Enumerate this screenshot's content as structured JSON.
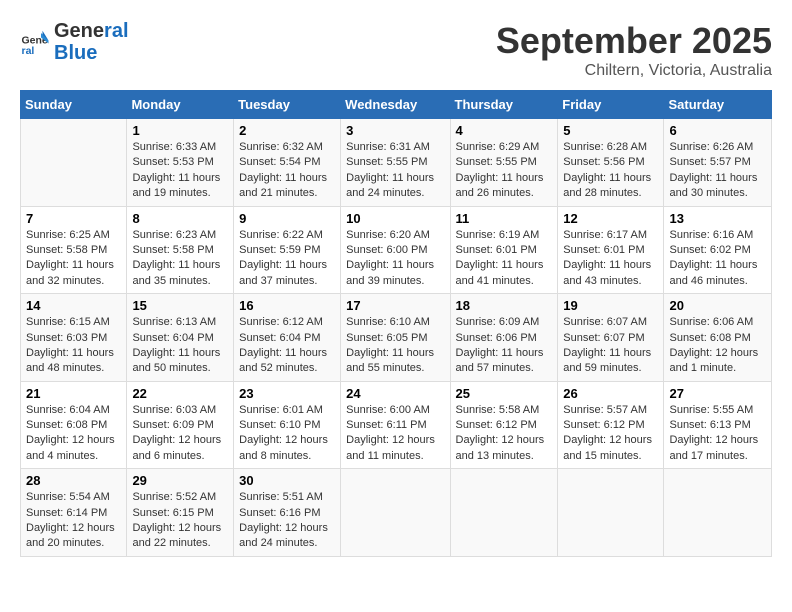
{
  "logo": {
    "line1": "General",
    "line2": "Blue"
  },
  "title": "September 2025",
  "subtitle": "Chiltern, Victoria, Australia",
  "headers": [
    "Sunday",
    "Monday",
    "Tuesday",
    "Wednesday",
    "Thursday",
    "Friday",
    "Saturday"
  ],
  "weeks": [
    [
      {
        "day": "",
        "info": ""
      },
      {
        "day": "1",
        "info": "Sunrise: 6:33 AM\nSunset: 5:53 PM\nDaylight: 11 hours\nand 19 minutes."
      },
      {
        "day": "2",
        "info": "Sunrise: 6:32 AM\nSunset: 5:54 PM\nDaylight: 11 hours\nand 21 minutes."
      },
      {
        "day": "3",
        "info": "Sunrise: 6:31 AM\nSunset: 5:55 PM\nDaylight: 11 hours\nand 24 minutes."
      },
      {
        "day": "4",
        "info": "Sunrise: 6:29 AM\nSunset: 5:55 PM\nDaylight: 11 hours\nand 26 minutes."
      },
      {
        "day": "5",
        "info": "Sunrise: 6:28 AM\nSunset: 5:56 PM\nDaylight: 11 hours\nand 28 minutes."
      },
      {
        "day": "6",
        "info": "Sunrise: 6:26 AM\nSunset: 5:57 PM\nDaylight: 11 hours\nand 30 minutes."
      }
    ],
    [
      {
        "day": "7",
        "info": "Sunrise: 6:25 AM\nSunset: 5:58 PM\nDaylight: 11 hours\nand 32 minutes."
      },
      {
        "day": "8",
        "info": "Sunrise: 6:23 AM\nSunset: 5:58 PM\nDaylight: 11 hours\nand 35 minutes."
      },
      {
        "day": "9",
        "info": "Sunrise: 6:22 AM\nSunset: 5:59 PM\nDaylight: 11 hours\nand 37 minutes."
      },
      {
        "day": "10",
        "info": "Sunrise: 6:20 AM\nSunset: 6:00 PM\nDaylight: 11 hours\nand 39 minutes."
      },
      {
        "day": "11",
        "info": "Sunrise: 6:19 AM\nSunset: 6:01 PM\nDaylight: 11 hours\nand 41 minutes."
      },
      {
        "day": "12",
        "info": "Sunrise: 6:17 AM\nSunset: 6:01 PM\nDaylight: 11 hours\nand 43 minutes."
      },
      {
        "day": "13",
        "info": "Sunrise: 6:16 AM\nSunset: 6:02 PM\nDaylight: 11 hours\nand 46 minutes."
      }
    ],
    [
      {
        "day": "14",
        "info": "Sunrise: 6:15 AM\nSunset: 6:03 PM\nDaylight: 11 hours\nand 48 minutes."
      },
      {
        "day": "15",
        "info": "Sunrise: 6:13 AM\nSunset: 6:04 PM\nDaylight: 11 hours\nand 50 minutes."
      },
      {
        "day": "16",
        "info": "Sunrise: 6:12 AM\nSunset: 6:04 PM\nDaylight: 11 hours\nand 52 minutes."
      },
      {
        "day": "17",
        "info": "Sunrise: 6:10 AM\nSunset: 6:05 PM\nDaylight: 11 hours\nand 55 minutes."
      },
      {
        "day": "18",
        "info": "Sunrise: 6:09 AM\nSunset: 6:06 PM\nDaylight: 11 hours\nand 57 minutes."
      },
      {
        "day": "19",
        "info": "Sunrise: 6:07 AM\nSunset: 6:07 PM\nDaylight: 11 hours\nand 59 minutes."
      },
      {
        "day": "20",
        "info": "Sunrise: 6:06 AM\nSunset: 6:08 PM\nDaylight: 12 hours\nand 1 minute."
      }
    ],
    [
      {
        "day": "21",
        "info": "Sunrise: 6:04 AM\nSunset: 6:08 PM\nDaylight: 12 hours\nand 4 minutes."
      },
      {
        "day": "22",
        "info": "Sunrise: 6:03 AM\nSunset: 6:09 PM\nDaylight: 12 hours\nand 6 minutes."
      },
      {
        "day": "23",
        "info": "Sunrise: 6:01 AM\nSunset: 6:10 PM\nDaylight: 12 hours\nand 8 minutes."
      },
      {
        "day": "24",
        "info": "Sunrise: 6:00 AM\nSunset: 6:11 PM\nDaylight: 12 hours\nand 11 minutes."
      },
      {
        "day": "25",
        "info": "Sunrise: 5:58 AM\nSunset: 6:12 PM\nDaylight: 12 hours\nand 13 minutes."
      },
      {
        "day": "26",
        "info": "Sunrise: 5:57 AM\nSunset: 6:12 PM\nDaylight: 12 hours\nand 15 minutes."
      },
      {
        "day": "27",
        "info": "Sunrise: 5:55 AM\nSunset: 6:13 PM\nDaylight: 12 hours\nand 17 minutes."
      }
    ],
    [
      {
        "day": "28",
        "info": "Sunrise: 5:54 AM\nSunset: 6:14 PM\nDaylight: 12 hours\nand 20 minutes."
      },
      {
        "day": "29",
        "info": "Sunrise: 5:52 AM\nSunset: 6:15 PM\nDaylight: 12 hours\nand 22 minutes."
      },
      {
        "day": "30",
        "info": "Sunrise: 5:51 AM\nSunset: 6:16 PM\nDaylight: 12 hours\nand 24 minutes."
      },
      {
        "day": "",
        "info": ""
      },
      {
        "day": "",
        "info": ""
      },
      {
        "day": "",
        "info": ""
      },
      {
        "day": "",
        "info": ""
      }
    ]
  ]
}
